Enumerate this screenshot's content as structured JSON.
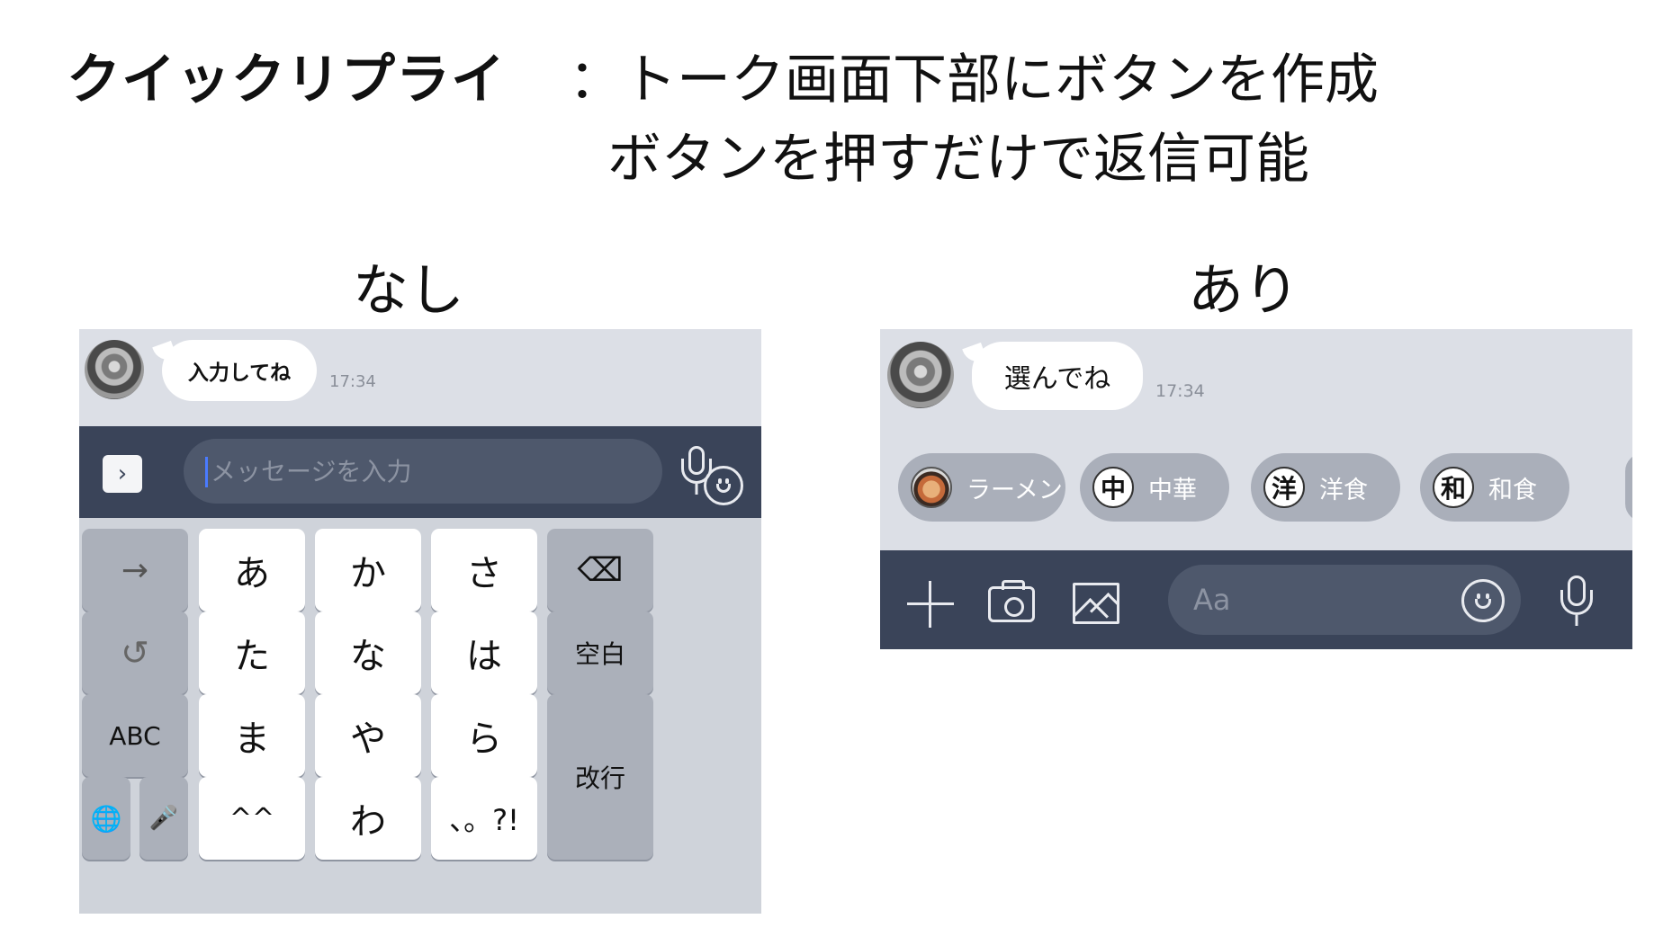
{
  "header": {
    "title": "クイックリプライ",
    "desc_line1": "：トーク画面下部にボタンを作成",
    "desc_line2": "ボタンを押すだけで返信可能"
  },
  "labels": {
    "without": "なし",
    "with": "あり"
  },
  "left_panel": {
    "message": "入力してね",
    "time": "17:34",
    "input_placeholder": "メッセージを入力",
    "keyboard": {
      "row1": [
        "→",
        "あ",
        "か",
        "さ",
        "⌫"
      ],
      "row2": [
        "↺",
        "た",
        "な",
        "は",
        "空白"
      ],
      "row3": [
        "ABC",
        "ま",
        "や",
        "ら"
      ],
      "row4": [
        "🌐",
        "🎤",
        "^^",
        "わ",
        "、。?!"
      ],
      "enter": "改行"
    }
  },
  "right_panel": {
    "message": "選んでね",
    "time": "17:34",
    "quick_replies": [
      {
        "icon": "ramen-photo",
        "glyph": "",
        "label": "ラーメン"
      },
      {
        "icon": "chinese-char-icon",
        "glyph": "中",
        "label": "中華"
      },
      {
        "icon": "western-char-icon",
        "glyph": "洋",
        "label": "洋食"
      },
      {
        "icon": "japanese-char-icon",
        "glyph": "和",
        "label": "和食"
      }
    ],
    "input_placeholder": "Aa"
  },
  "colors": {
    "chat_bg": "#dcdfe6",
    "bar_bg": "#3a4459",
    "chip_bg": "#aaafba",
    "keyboard_bg": "#cfd3da"
  }
}
